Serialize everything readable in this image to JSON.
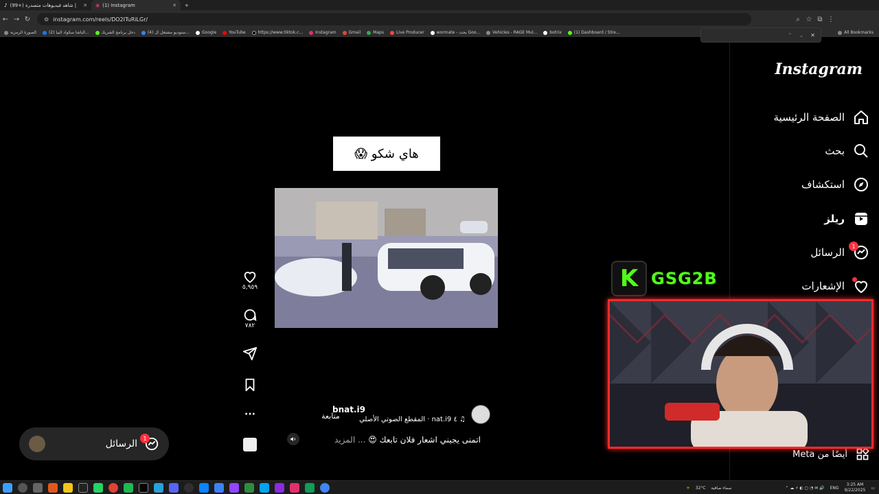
{
  "browser": {
    "tabs": [
      {
        "title": "(99+) شاهد فيديوهات متصدرة |",
        "active": false
      },
      {
        "title": "(1) Instagram",
        "active": true
      }
    ],
    "new_tab": "+",
    "url": "instagram.com/reels/DO2ITuRiLGr/",
    "bookmarks": [
      "الصورة الرمزية",
      "(2) الباشا سكواد البيا...",
      "دخل برنامج الشريك",
      "(4) ستوديو مشتغل ال...",
      "Google",
      "YouTube",
      "https://www.tiktok.c...",
      "Instagram",
      "Gmail",
      "Maps",
      "Live Producer",
      "wormate - بحث Goo...",
      "Vehicles - RAGE Mul...",
      "botrix",
      "(1) Dashboard / Stre..."
    ],
    "all_bookmarks": "All Bookmarks"
  },
  "sidebar": {
    "logo": "Instagram",
    "items": [
      {
        "label": "الصفحة الرئيسية",
        "icon": "home-icon"
      },
      {
        "label": "بحث",
        "icon": "search-icon"
      },
      {
        "label": "استكشاف",
        "icon": "explore-icon"
      },
      {
        "label": "ريلز",
        "icon": "reels-icon"
      },
      {
        "label": "الرسائل",
        "icon": "messenger-icon",
        "badge": "1"
      },
      {
        "label": "الإشعارات",
        "icon": "heart-icon",
        "dot": true
      }
    ],
    "meta_label": "أيضًا من Meta"
  },
  "reel": {
    "caption_overlay": "هاي شكو 😱",
    "username": "bnat.i9",
    "follow": "متابعة",
    "audio": "nat.i9 · المقطع الصوتي الأصلي",
    "description": "اتمنى يجيني اشعار فلان تابعك 😍",
    "more": "... المزيد",
    "likes": "٥,٩٥٩",
    "comments": "٧٨٢"
  },
  "messages_pill": {
    "label": "الرسائل",
    "badge": "1"
  },
  "overlay": {
    "brand_text": "GSG2B",
    "brand_letter": "K"
  },
  "taskbar": {
    "weather_temp": "32°C",
    "weather_text": "سماء صافية",
    "lang": "ENG",
    "time": "3:25 AM",
    "date": "9/22/2025"
  }
}
